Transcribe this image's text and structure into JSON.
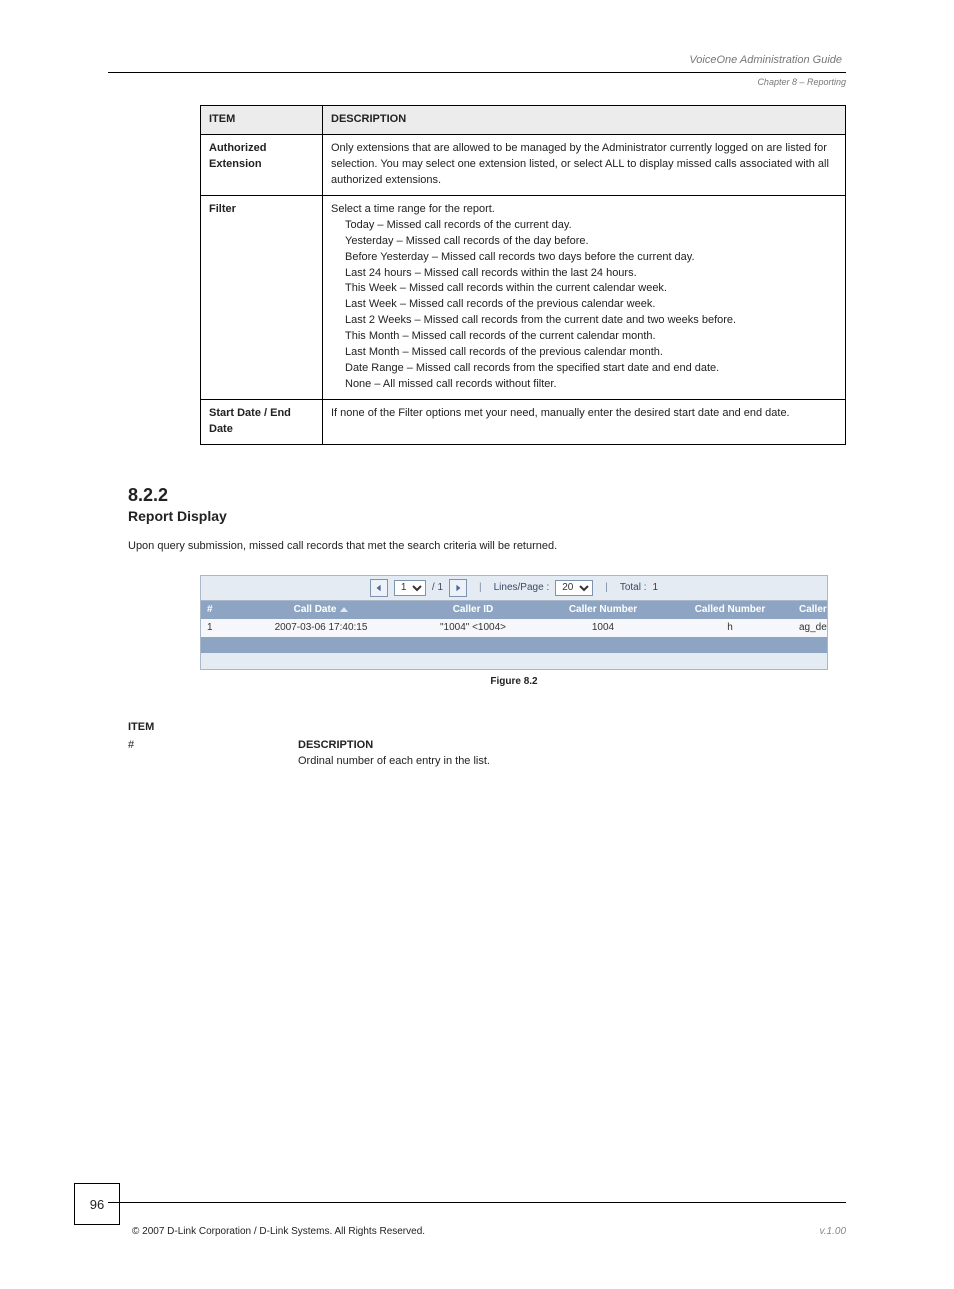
{
  "header": {
    "running": "VoiceOne Administration Guide",
    "chapter": "Chapter 8 – Reporting"
  },
  "spec_table": {
    "head": {
      "item": "ITEM",
      "desc": "DESCRIPTION"
    },
    "rows": [
      {
        "label": "Authorized Extension",
        "desc": "Only extensions that are allowed to be managed by the Administrator currently logged on are listed for selection. You may select one extension listed, or select ALL to display missed calls associated with all authorized extensions."
      },
      {
        "label": "Filter",
        "desc_intro": "Select a time range for the report.",
        "desc_items": [
          "Today – Missed call records of the current day.",
          "Yesterday – Missed call records of the day before.",
          "Before Yesterday – Missed call records two days before the current day.",
          "Last 24 hours – Missed call records within the last 24 hours.",
          "This Week – Missed call records within the current calendar week.",
          "Last Week – Missed call records of the previous calendar week.",
          "Last 2 Weeks – Missed call records from the current date and two weeks before.",
          "This Month – Missed call records of the current calendar month.",
          "Last Month – Missed call records of the previous calendar month.",
          "Date Range – Missed call records from the specified start date and end date.",
          "None – All missed call records without filter."
        ]
      },
      {
        "label": "Start Date / End Date",
        "desc": "If none of the Filter options met your need, manually enter the desired start date and end date."
      }
    ]
  },
  "section": {
    "num": "8.2.2",
    "title": "Report Display",
    "body": "Upon query submission, missed call records that met the search criteria will be returned."
  },
  "figure": {
    "pager": {
      "page_sel": "1",
      "total_pages": "1",
      "lines_label": "Lines/Page :",
      "lines_sel": "20",
      "total_label": "Total :",
      "total": "1"
    },
    "columns": {
      "idx": "#",
      "date": "Call Date",
      "cid": "Caller ID",
      "cnum": "Caller Number",
      "cdn": "Called Number",
      "grp": "Caller Group"
    },
    "row": {
      "idx": "1",
      "date": "2007-03-06 17:40:15",
      "cid": "\"1004\" <1004>",
      "cnum": "1004",
      "cdn": "h",
      "grp": "ag_default"
    },
    "caption": "Figure 8.2"
  },
  "bottom": {
    "label": "ITEM",
    "col_label": "#",
    "col_desc_hdr": "DESCRIPTION",
    "col_desc": "Ordinal number of each entry in the list."
  },
  "footer": {
    "page": "96",
    "left": "© 2007 D-Link Corporation / D-Link Systems. All Rights Reserved.",
    "right": "v.1.00"
  }
}
